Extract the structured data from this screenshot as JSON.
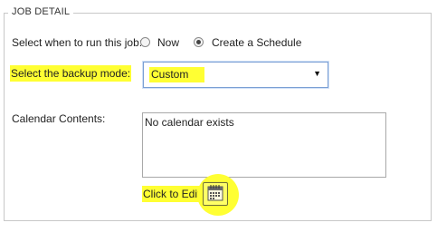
{
  "fieldset": {
    "legend": "JOB DETAIL"
  },
  "run_when": {
    "label": "Select when to run this job:",
    "options": [
      {
        "label": "Now",
        "checked": false
      },
      {
        "label": "Create a Schedule",
        "checked": true
      }
    ]
  },
  "backup_mode": {
    "label": "Select the backup mode:",
    "value": "Custom",
    "arrow_icon": "triangle-down-icon"
  },
  "calendar": {
    "label": "Calendar Contents:",
    "contents": "No calendar exists",
    "edit_label": "Click to Edit:",
    "edit_icon": "calendar-icon"
  },
  "colors": {
    "highlight": "#ffff33",
    "border": "#c8c8c8",
    "focus": "#7b9fd4"
  }
}
